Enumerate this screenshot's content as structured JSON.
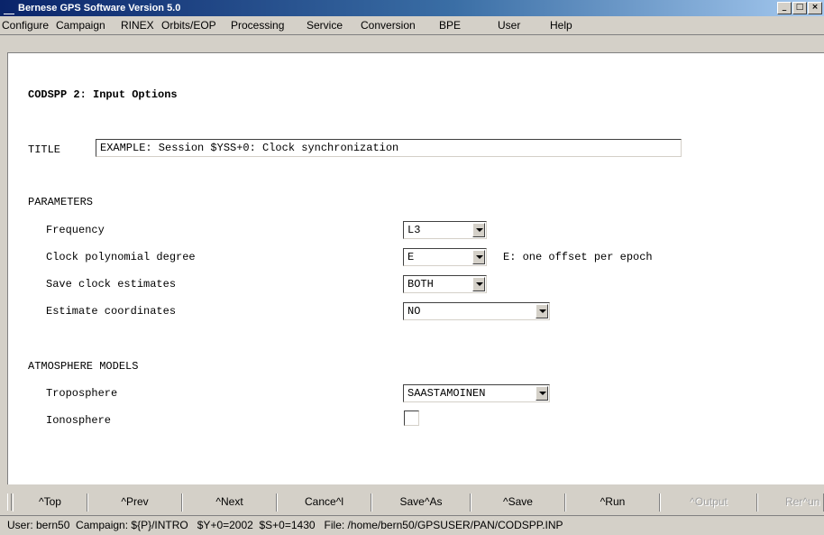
{
  "window": {
    "title": "Bernese GPS Software Version 5.0"
  },
  "window_controls": {
    "minimize": "_",
    "maximize": "□",
    "close": "×"
  },
  "menubar": {
    "items": [
      "Configure",
      "Campaign",
      "RINEX",
      "Orbits/EOP",
      "Processing",
      "Service",
      "Conversion",
      "BPE",
      "User",
      "Help"
    ]
  },
  "form": {
    "heading": "CODSPP 2: Input Options",
    "title_label": "TITLE",
    "title_value": "EXAMPLE: Session $YSS+0: Clock synchronization",
    "parameters_header": "PARAMETERS",
    "frequency_label": "Frequency",
    "frequency_value": "L3",
    "clock_degree_label": "Clock polynomial degree",
    "clock_degree_value": "E",
    "clock_degree_note": "E: one offset per epoch",
    "save_clock_label": "Save clock estimates",
    "save_clock_value": "BOTH",
    "estimate_coord_label": "Estimate coordinates",
    "estimate_coord_value": "NO",
    "atmosphere_header": "ATMOSPHERE MODELS",
    "troposphere_label": "Troposphere",
    "troposphere_value": "SAASTAMOINEN",
    "ionosphere_label": "Ionosphere",
    "ionosphere_checked": false
  },
  "buttons": {
    "top": "^Top",
    "prev": "^Prev",
    "next": "^Next",
    "cancel": "Cance^l",
    "saveas": "Save^As",
    "save": "^Save",
    "run": "^Run",
    "output": "^Output",
    "rerun": "Rer^un"
  },
  "status": {
    "text": "User: bern50  Campaign: ${P}/INTRO   $Y+0=2002  $S+0=1430   File: /home/bern50/GPSUSER/PAN/CODSPP.INP"
  }
}
